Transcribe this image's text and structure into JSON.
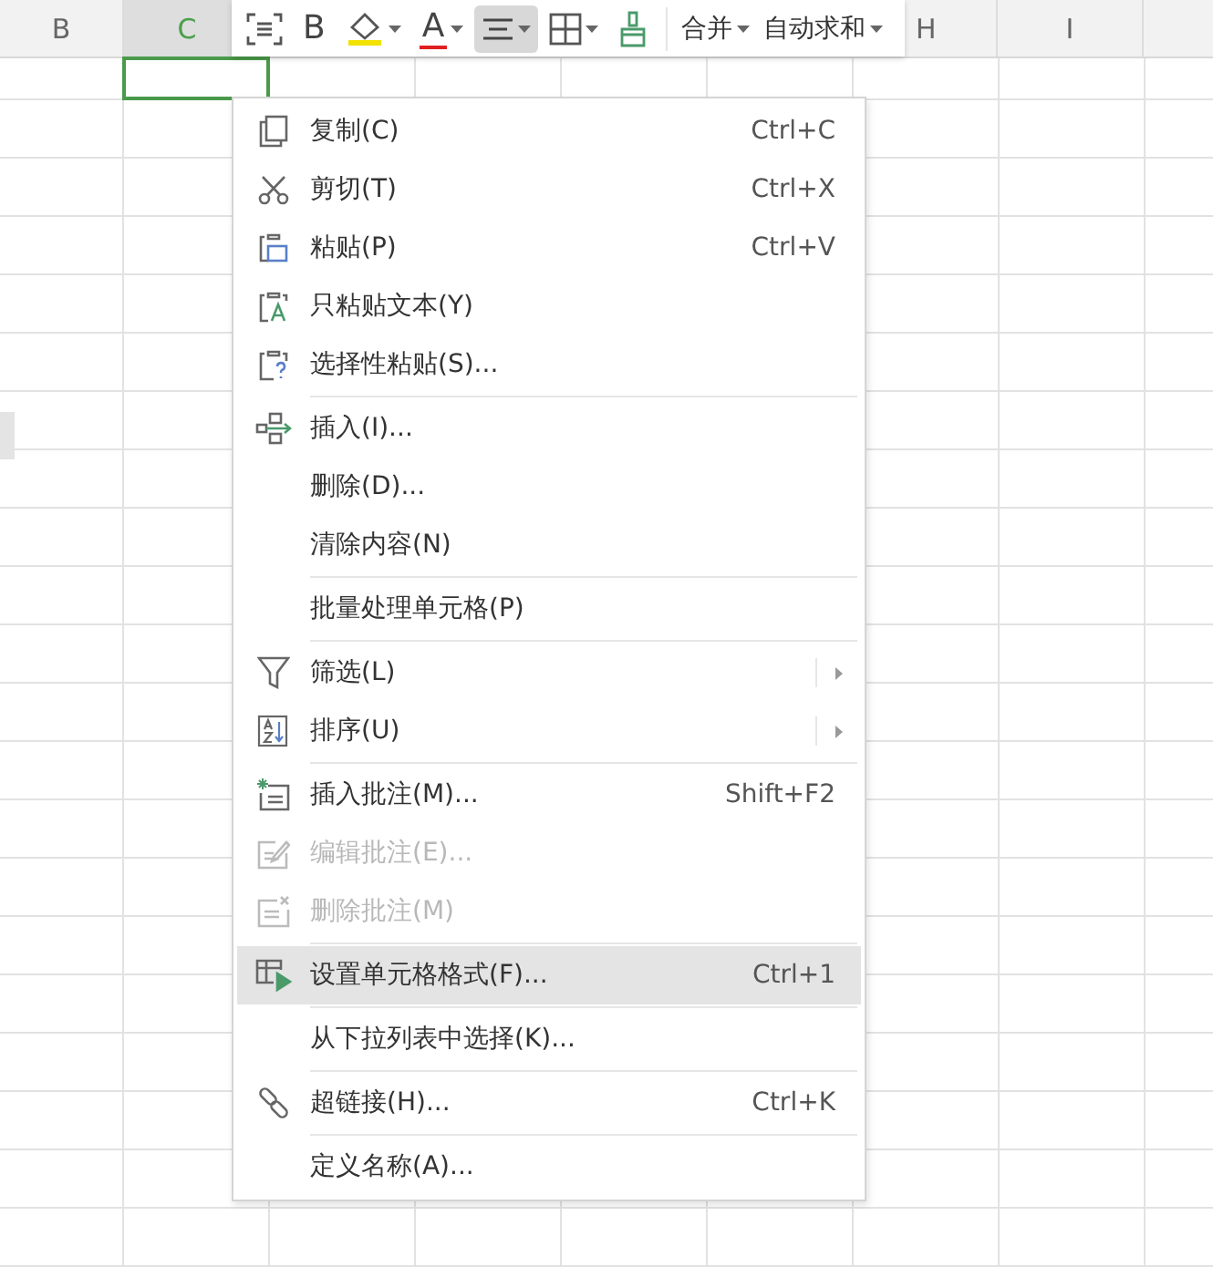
{
  "column_headers": [
    {
      "label": "B",
      "selected": false
    },
    {
      "label": "C",
      "selected": true
    },
    {
      "label": "H",
      "selected": false
    },
    {
      "label": "I",
      "selected": false
    }
  ],
  "toolbar": {
    "items": [
      {
        "kind": "icon",
        "dropdown": false,
        "selected": false
      },
      {
        "kind": "glyph",
        "text": "B",
        "dropdown": false,
        "selected": false
      },
      {
        "kind": "icon",
        "dropdown": true,
        "selected": false
      },
      {
        "kind": "glyph",
        "text": "A",
        "color": "#e02020",
        "dropdown": true,
        "selected": false
      },
      {
        "kind": "icon",
        "dropdown": true,
        "selected": true
      },
      {
        "kind": "icon",
        "dropdown": true,
        "selected": false
      },
      {
        "kind": "icon",
        "dropdown": false,
        "selected": false
      },
      {
        "kind": "text",
        "text": "合并",
        "dropdown": true,
        "selected": false
      },
      {
        "kind": "text",
        "text": "自动求和",
        "dropdown": true,
        "selected": false
      }
    ]
  },
  "context_menu": {
    "groups": [
      [
        {
          "label": "复制(C)",
          "shortcut": "Ctrl+C",
          "disabled": false,
          "selected": false,
          "submenu": false
        },
        {
          "label": "剪切(T)",
          "shortcut": "Ctrl+X",
          "disabled": false,
          "selected": false,
          "submenu": false
        },
        {
          "label": "粘贴(P)",
          "shortcut": "Ctrl+V",
          "disabled": false,
          "selected": false,
          "submenu": false
        },
        {
          "label": "只粘贴文本(Y)",
          "disabled": false,
          "selected": false,
          "submenu": false
        },
        {
          "label": "选择性粘贴(S)...",
          "disabled": false,
          "selected": false,
          "submenu": false
        }
      ],
      [
        {
          "label": "插入(I)...",
          "disabled": false,
          "selected": false,
          "submenu": false
        },
        {
          "label": "删除(D)...",
          "disabled": false,
          "selected": false,
          "submenu": false
        },
        {
          "label": "清除内容(N)",
          "disabled": false,
          "selected": false,
          "submenu": false
        }
      ],
      [
        {
          "label": "批量处理单元格(P)",
          "disabled": false,
          "selected": false,
          "submenu": false
        }
      ],
      [
        {
          "label": "筛选(L)",
          "disabled": false,
          "selected": false,
          "submenu": true
        },
        {
          "label": "排序(U)",
          "disabled": false,
          "selected": false,
          "submenu": true
        }
      ],
      [
        {
          "label": "插入批注(M)...",
          "shortcut": "Shift+F2",
          "disabled": false,
          "selected": false,
          "submenu": false
        },
        {
          "label": "编辑批注(E)...",
          "disabled": true,
          "selected": false,
          "submenu": false
        },
        {
          "label": "删除批注(M)",
          "disabled": true,
          "selected": false,
          "submenu": false
        }
      ],
      [
        {
          "label": "设置单元格格式(F)...",
          "shortcut": "Ctrl+1",
          "disabled": false,
          "selected": true,
          "submenu": false
        }
      ],
      [
        {
          "label": "从下拉列表中选择(K)...",
          "disabled": false,
          "selected": false,
          "submenu": false
        }
      ],
      [
        {
          "label": "超链接(H)...",
          "shortcut": "Ctrl+K",
          "disabled": false,
          "selected": false,
          "submenu": false
        }
      ],
      [
        {
          "label": "定义名称(A)...",
          "disabled": false,
          "selected": false,
          "submenu": false
        }
      ]
    ]
  }
}
